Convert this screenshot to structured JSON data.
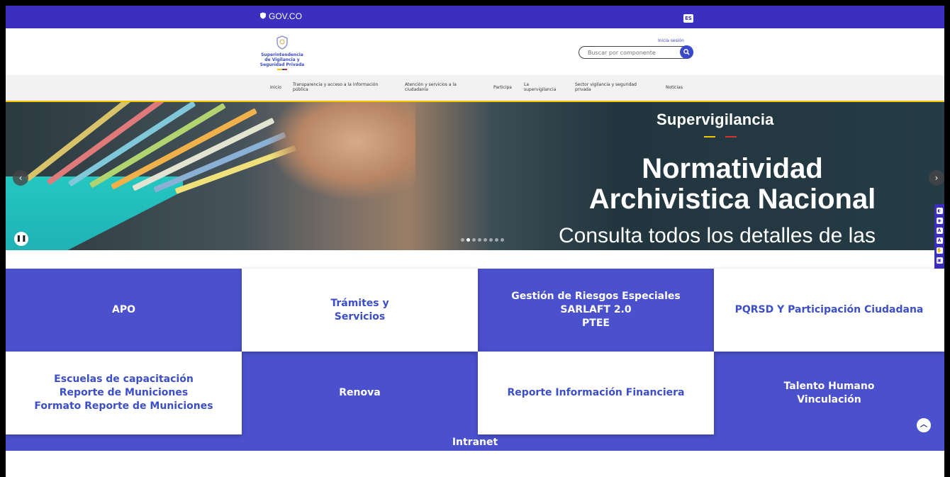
{
  "govbar": {
    "logo_text": "GOV.CO",
    "lang": "ES"
  },
  "header": {
    "entity_name_lines": [
      "Superintendencia",
      "de Vigilancia y",
      "Seguridad Privada"
    ],
    "login": "Inicia sesión",
    "search_placeholder": "Buscar por componente",
    "search_icon": "search-icon"
  },
  "nav": {
    "items": [
      "Inicio",
      "Transparencia y acceso a la información pública",
      "Atención y servicios a la ciudadanía",
      "Participa",
      "La supervigilancia",
      "Sector vigilancia y seguridad privada",
      "Noticias"
    ]
  },
  "hero": {
    "brand": "Supervigilancia",
    "title": "Normatividad Archivistica Nacional",
    "subtitle": "Consulta todos los detalles de las",
    "slide_count": 8,
    "active_slide": 1,
    "colors": {
      "yellow": "#f2c500",
      "red": "#d7312d"
    }
  },
  "tiles": [
    {
      "lines": [
        "APO"
      ],
      "style": "blue"
    },
    {
      "lines": [
        "Trámites y",
        "Servicios"
      ],
      "style": "white"
    },
    {
      "lines": [
        "Gestión de Riesgos Especiales",
        "SARLAFT 2.0",
        "PTEE"
      ],
      "style": "blue"
    },
    {
      "lines": [
        "PQRSD Y Participación Ciudadana"
      ],
      "style": "white"
    },
    {
      "lines": [
        "Escuelas de capacitación",
        "Reporte de Municiones",
        "Formato Reporte de Municiones"
      ],
      "style": "white"
    },
    {
      "lines": [
        "Renova"
      ],
      "style": "blue"
    },
    {
      "lines": [
        "Reporte Información Financiera"
      ],
      "style": "white"
    },
    {
      "lines": [
        "Talento Humano",
        "Vinculación"
      ],
      "style": "blue"
    }
  ],
  "intranet": "Intranet",
  "colors": {
    "primary": "#3a2fbf",
    "tile_blue": "#4b51cc",
    "link_blue": "#3c4ec8",
    "accent_yellow": "#f2c500"
  }
}
